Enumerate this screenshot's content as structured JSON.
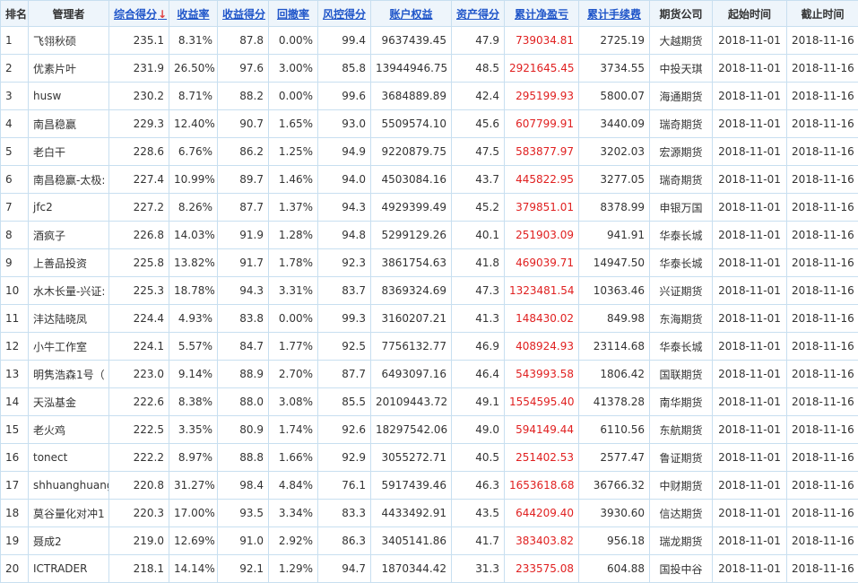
{
  "headers": {
    "rank": "排名",
    "manager": "管理者",
    "composite": "综合得分",
    "sort_arrow": "↓",
    "return_rate": "收益率",
    "return_score": "收益得分",
    "drawdown": "回撤率",
    "risk_score": "风控得分",
    "equity": "账户权益",
    "asset_score": "资产得分",
    "cum_pnl": "累计净盈亏",
    "cum_fee": "累计手续费",
    "company": "期货公司",
    "start": "起始时间",
    "end": "截止时间"
  },
  "colors": {
    "link": "#1f55c9",
    "pnl": "#e02020",
    "border": "#c8dff0",
    "header_bg": "#eef5fb"
  },
  "rows": [
    {
      "rank": "1",
      "manager": "飞翎秋硕",
      "composite": "235.1",
      "return_rate": "8.31%",
      "return_score": "87.8",
      "drawdown": "0.00%",
      "risk_score": "99.4",
      "equity": "9637439.45",
      "asset_score": "47.9",
      "cum_pnl": "739034.81",
      "cum_fee": "2725.19",
      "company": "大越期货",
      "start": "2018-11-01",
      "end": "2018-11-16"
    },
    {
      "rank": "2",
      "manager": "优素片叶",
      "composite": "231.9",
      "return_rate": "26.50%",
      "return_score": "97.6",
      "drawdown": "3.00%",
      "risk_score": "85.8",
      "equity": "13944946.75",
      "asset_score": "48.5",
      "cum_pnl": "2921645.45",
      "cum_fee": "3734.55",
      "company": "中投天琪",
      "start": "2018-11-01",
      "end": "2018-11-16"
    },
    {
      "rank": "3",
      "manager": "husw",
      "composite": "230.2",
      "return_rate": "8.71%",
      "return_score": "88.2",
      "drawdown": "0.00%",
      "risk_score": "99.6",
      "equity": "3684889.89",
      "asset_score": "42.4",
      "cum_pnl": "295199.93",
      "cum_fee": "5800.07",
      "company": "海通期货",
      "start": "2018-11-01",
      "end": "2018-11-16"
    },
    {
      "rank": "4",
      "manager": "南昌稳赢",
      "composite": "229.3",
      "return_rate": "12.40%",
      "return_score": "90.7",
      "drawdown": "1.65%",
      "risk_score": "93.0",
      "equity": "5509574.10",
      "asset_score": "45.6",
      "cum_pnl": "607799.91",
      "cum_fee": "3440.09",
      "company": "瑞奇期货",
      "start": "2018-11-01",
      "end": "2018-11-16"
    },
    {
      "rank": "5",
      "manager": "老白干",
      "composite": "228.6",
      "return_rate": "6.76%",
      "return_score": "86.2",
      "drawdown": "1.25%",
      "risk_score": "94.9",
      "equity": "9220879.75",
      "asset_score": "47.5",
      "cum_pnl": "583877.97",
      "cum_fee": "3202.03",
      "company": "宏源期货",
      "start": "2018-11-01",
      "end": "2018-11-16"
    },
    {
      "rank": "6",
      "manager": "南昌稳赢-太极:",
      "composite": "227.4",
      "return_rate": "10.99%",
      "return_score": "89.7",
      "drawdown": "1.46%",
      "risk_score": "94.0",
      "equity": "4503084.16",
      "asset_score": "43.7",
      "cum_pnl": "445822.95",
      "cum_fee": "3277.05",
      "company": "瑞奇期货",
      "start": "2018-11-01",
      "end": "2018-11-16"
    },
    {
      "rank": "7",
      "manager": "jfc2",
      "composite": "227.2",
      "return_rate": "8.26%",
      "return_score": "87.7",
      "drawdown": "1.37%",
      "risk_score": "94.3",
      "equity": "4929399.49",
      "asset_score": "45.2",
      "cum_pnl": "379851.01",
      "cum_fee": "8378.99",
      "company": "申银万国",
      "start": "2018-11-01",
      "end": "2018-11-16"
    },
    {
      "rank": "8",
      "manager": "酒疯子",
      "composite": "226.8",
      "return_rate": "14.03%",
      "return_score": "91.9",
      "drawdown": "1.28%",
      "risk_score": "94.8",
      "equity": "5299129.26",
      "asset_score": "40.1",
      "cum_pnl": "251903.09",
      "cum_fee": "941.91",
      "company": "华泰长城",
      "start": "2018-11-01",
      "end": "2018-11-16"
    },
    {
      "rank": "9",
      "manager": "上善品投资",
      "composite": "225.8",
      "return_rate": "13.82%",
      "return_score": "91.7",
      "drawdown": "1.78%",
      "risk_score": "92.3",
      "equity": "3861754.63",
      "asset_score": "41.8",
      "cum_pnl": "469039.71",
      "cum_fee": "14947.50",
      "company": "华泰长城",
      "start": "2018-11-01",
      "end": "2018-11-16"
    },
    {
      "rank": "10",
      "manager": "水木长量-兴证:",
      "composite": "225.3",
      "return_rate": "18.78%",
      "return_score": "94.3",
      "drawdown": "3.31%",
      "risk_score": "83.7",
      "equity": "8369324.69",
      "asset_score": "47.3",
      "cum_pnl": "1323481.54",
      "cum_fee": "10363.46",
      "company": "兴证期货",
      "start": "2018-11-01",
      "end": "2018-11-16"
    },
    {
      "rank": "11",
      "manager": "沣达陆晓凤",
      "composite": "224.4",
      "return_rate": "4.93%",
      "return_score": "83.8",
      "drawdown": "0.00%",
      "risk_score": "99.3",
      "equity": "3160207.21",
      "asset_score": "41.3",
      "cum_pnl": "148430.02",
      "cum_fee": "849.98",
      "company": "东海期货",
      "start": "2018-11-01",
      "end": "2018-11-16"
    },
    {
      "rank": "12",
      "manager": "小牛工作室",
      "composite": "224.1",
      "return_rate": "5.57%",
      "return_score": "84.7",
      "drawdown": "1.77%",
      "risk_score": "92.5",
      "equity": "7756132.77",
      "asset_score": "46.9",
      "cum_pnl": "408924.93",
      "cum_fee": "23114.68",
      "company": "华泰长城",
      "start": "2018-11-01",
      "end": "2018-11-16"
    },
    {
      "rank": "13",
      "manager": "明隽浩森1号（",
      "composite": "223.0",
      "return_rate": "9.14%",
      "return_score": "88.9",
      "drawdown": "2.70%",
      "risk_score": "87.7",
      "equity": "6493097.16",
      "asset_score": "46.4",
      "cum_pnl": "543993.58",
      "cum_fee": "1806.42",
      "company": "国联期货",
      "start": "2018-11-01",
      "end": "2018-11-16"
    },
    {
      "rank": "14",
      "manager": "天泓基金",
      "composite": "222.6",
      "return_rate": "8.38%",
      "return_score": "88.0",
      "drawdown": "3.08%",
      "risk_score": "85.5",
      "equity": "20109443.72",
      "asset_score": "49.1",
      "cum_pnl": "1554595.40",
      "cum_fee": "41378.28",
      "company": "南华期货",
      "start": "2018-11-01",
      "end": "2018-11-16"
    },
    {
      "rank": "15",
      "manager": "老火鸡",
      "composite": "222.5",
      "return_rate": "3.35%",
      "return_score": "80.9",
      "drawdown": "1.74%",
      "risk_score": "92.6",
      "equity": "18297542.06",
      "asset_score": "49.0",
      "cum_pnl": "594149.44",
      "cum_fee": "6110.56",
      "company": "东航期货",
      "start": "2018-11-01",
      "end": "2018-11-16"
    },
    {
      "rank": "16",
      "manager": "tonect",
      "composite": "222.2",
      "return_rate": "8.97%",
      "return_score": "88.8",
      "drawdown": "1.66%",
      "risk_score": "92.9",
      "equity": "3055272.71",
      "asset_score": "40.5",
      "cum_pnl": "251402.53",
      "cum_fee": "2577.47",
      "company": "鲁证期货",
      "start": "2018-11-01",
      "end": "2018-11-16"
    },
    {
      "rank": "17",
      "manager": "shhuanghuang",
      "composite": "220.8",
      "return_rate": "31.27%",
      "return_score": "98.4",
      "drawdown": "4.84%",
      "risk_score": "76.1",
      "equity": "5917439.46",
      "asset_score": "46.3",
      "cum_pnl": "1653618.68",
      "cum_fee": "36766.32",
      "company": "中财期货",
      "start": "2018-11-01",
      "end": "2018-11-16"
    },
    {
      "rank": "18",
      "manager": "莫谷量化对冲1",
      "composite": "220.3",
      "return_rate": "17.00%",
      "return_score": "93.5",
      "drawdown": "3.34%",
      "risk_score": "83.3",
      "equity": "4433492.91",
      "asset_score": "43.5",
      "cum_pnl": "644209.40",
      "cum_fee": "3930.60",
      "company": "信达期货",
      "start": "2018-11-01",
      "end": "2018-11-16"
    },
    {
      "rank": "19",
      "manager": "聂成2",
      "composite": "219.0",
      "return_rate": "12.69%",
      "return_score": "91.0",
      "drawdown": "2.92%",
      "risk_score": "86.3",
      "equity": "3405141.86",
      "asset_score": "41.7",
      "cum_pnl": "383403.82",
      "cum_fee": "956.18",
      "company": "瑞龙期货",
      "start": "2018-11-01",
      "end": "2018-11-16"
    },
    {
      "rank": "20",
      "manager": "ICTRADER",
      "composite": "218.1",
      "return_rate": "14.14%",
      "return_score": "92.1",
      "drawdown": "1.29%",
      "risk_score": "94.7",
      "equity": "1870344.42",
      "asset_score": "31.3",
      "cum_pnl": "233575.08",
      "cum_fee": "604.88",
      "company": "国投中谷",
      "start": "2018-11-01",
      "end": "2018-11-16"
    }
  ]
}
